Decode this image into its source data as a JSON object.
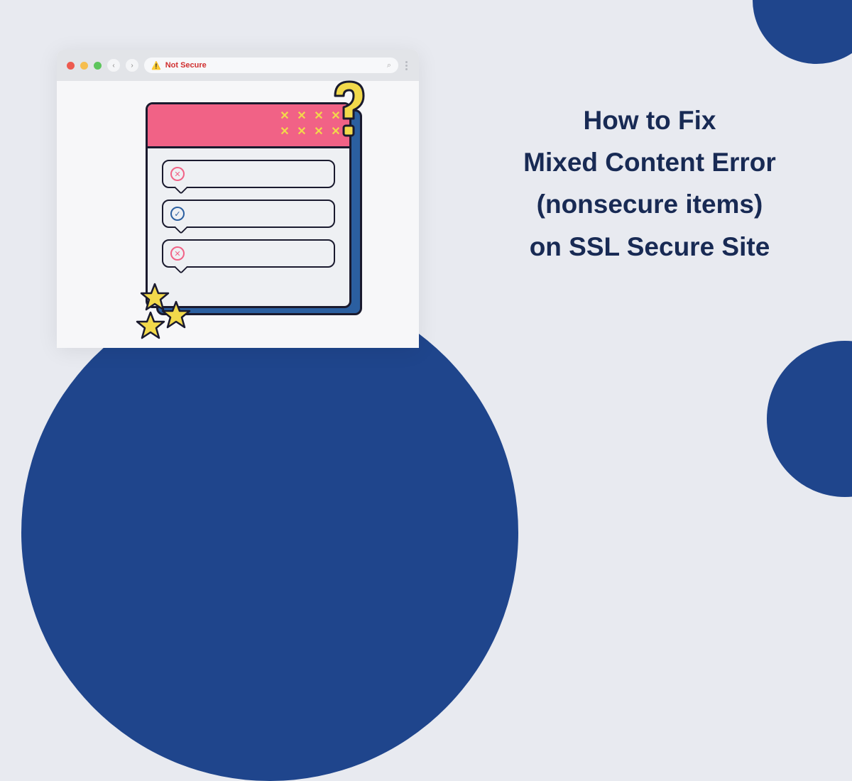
{
  "colors": {
    "bg": "#e8eaf0",
    "accent": "#1f458c",
    "headline": "#182a54",
    "pink": "#f16286",
    "yellow": "#f2d94b",
    "error_red": "#d02f2f"
  },
  "browser": {
    "security_status": "Not Secure"
  },
  "headline": {
    "line1": "How to Fix",
    "line2": "Mixed Content Error",
    "line3": "(nonsecure items)",
    "line4": "on SSL Secure Site"
  },
  "card": {
    "rows": [
      {
        "status": "error"
      },
      {
        "status": "ok"
      },
      {
        "status": "error"
      }
    ]
  }
}
